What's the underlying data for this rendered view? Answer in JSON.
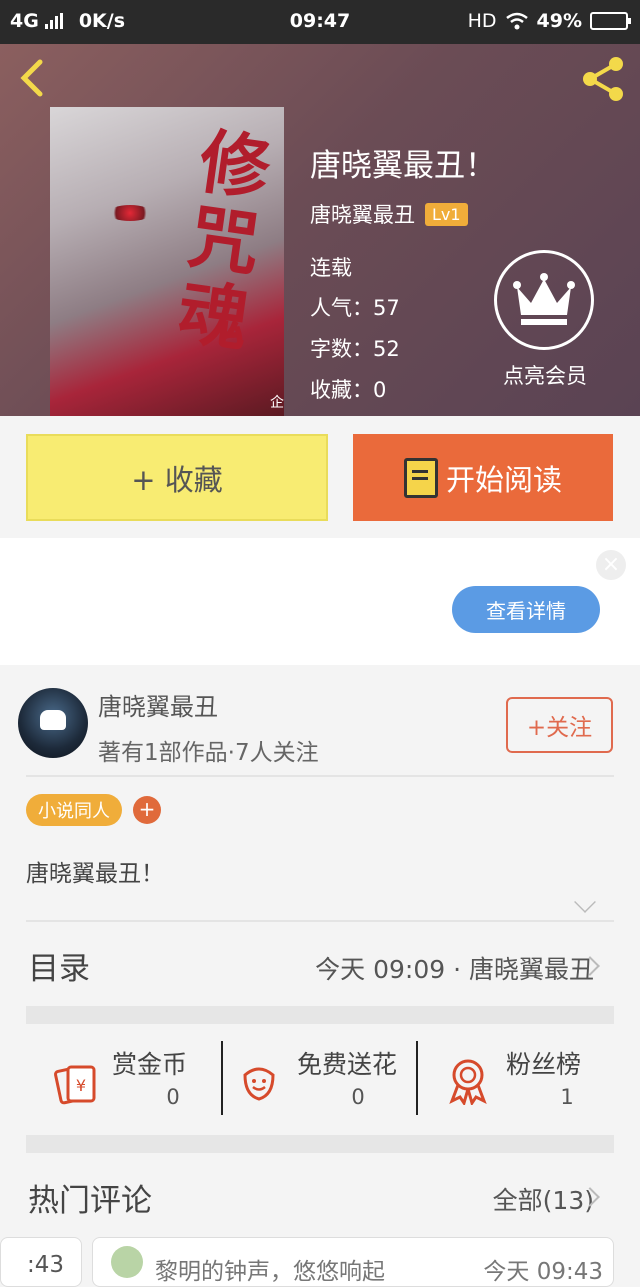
{
  "status_bar": {
    "network": "4G",
    "speed": "0K/s",
    "time": "09:47",
    "hd": "HD",
    "battery": "49%"
  },
  "book": {
    "title": "唐晓翼最丑！",
    "author": "唐晓翼最丑",
    "level": "Lv1",
    "status": "连载",
    "popularity": "人气：57",
    "words": "字数：52",
    "favorites": "收藏：0",
    "vip_label": "点亮会员"
  },
  "actions": {
    "favorite_label": "+ 收藏",
    "read_label": "开始阅读"
  },
  "ad": {
    "detail_label": "查看详情",
    "close": "×"
  },
  "author": {
    "name": "唐晓翼最丑",
    "stats": "著有1部作品·7人关注",
    "follow_label": "+关注",
    "tag": "小说同人",
    "tag_add": "+",
    "description": "唐晓翼最丑！"
  },
  "toc": {
    "label": "目录",
    "meta": "今天 09:09 · 唐晓翼最丑"
  },
  "stats": [
    {
      "label": "赏金币",
      "value": "0",
      "icon": "reward-coin-icon"
    },
    {
      "label": "免费送花",
      "value": "0",
      "icon": "flower-icon"
    },
    {
      "label": "粉丝榜",
      "value": "1",
      "icon": "medal-icon"
    }
  ],
  "comments": {
    "label": "热门评论",
    "all_label": "全部(13)",
    "prev_time_fragment": ":43",
    "item": {
      "text": "黎明的钟声，悠悠响起",
      "time": "今天 09:43"
    }
  },
  "colors": {
    "accent_orange": "#ea6a3b",
    "favorite_yellow": "#f8ec72",
    "link_blue": "#5b9be4",
    "level_badge": "#f0ad3a"
  }
}
